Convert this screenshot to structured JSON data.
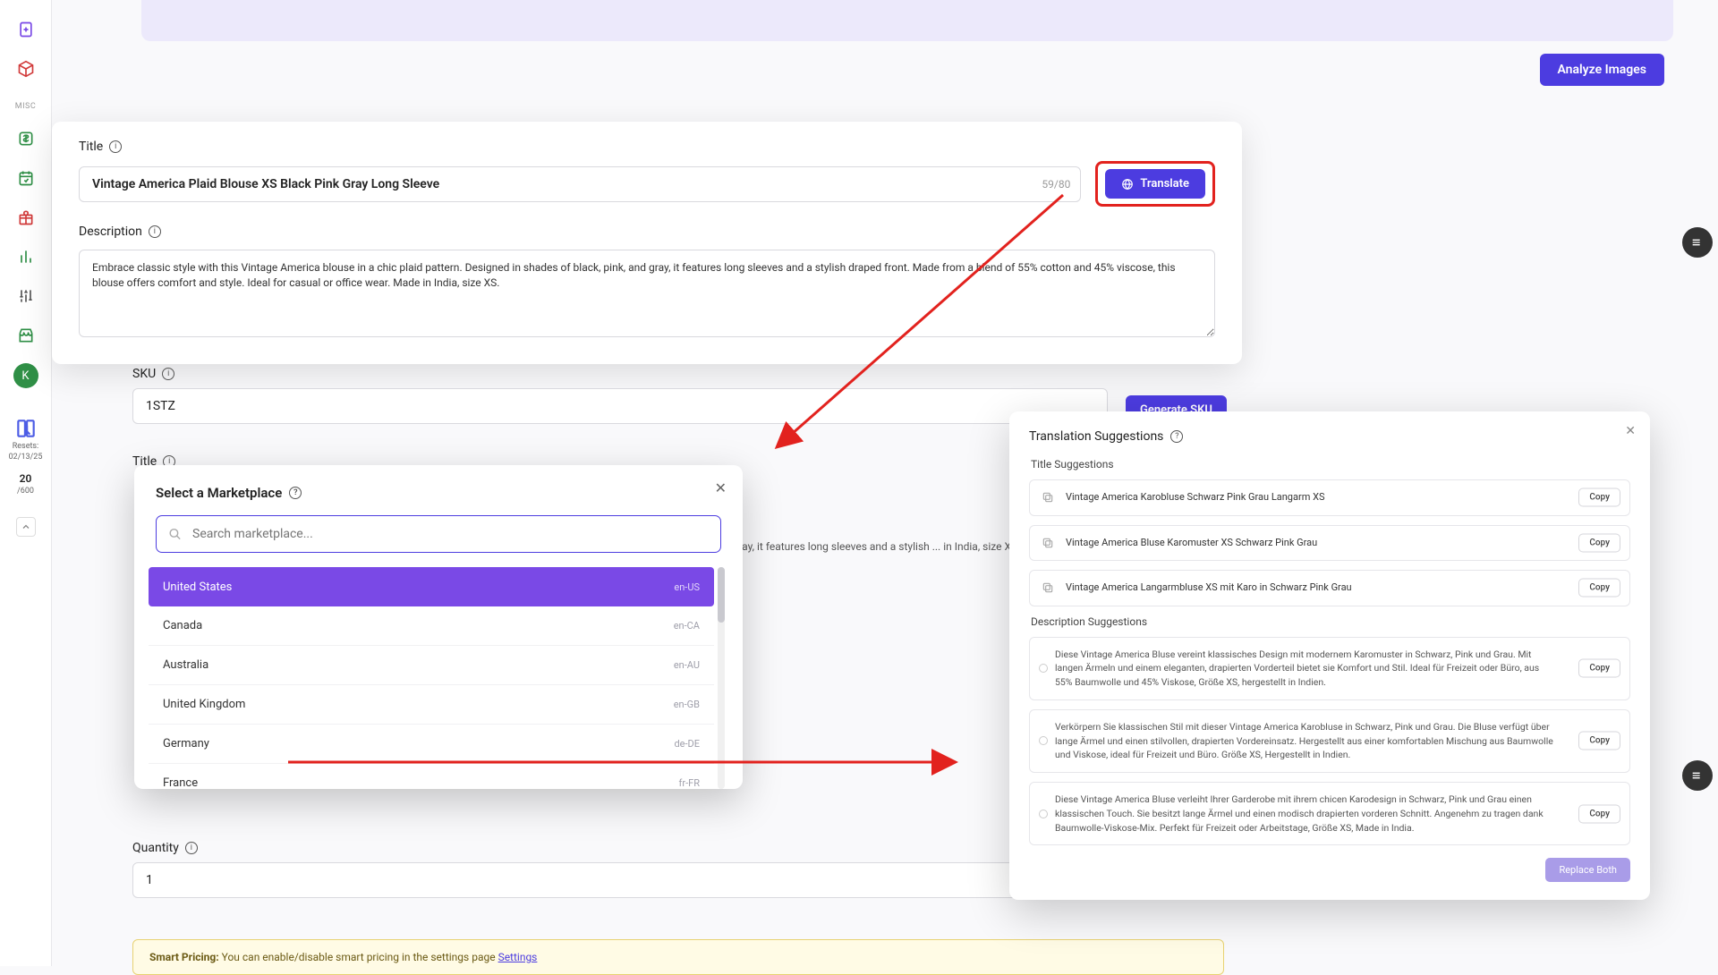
{
  "sidebar": {
    "misc_label": "MISC",
    "avatar_initial": "K",
    "resets_label": "Resets:",
    "resets_date": "02/13/25",
    "count_current": "20",
    "count_max": "/600"
  },
  "header": {
    "analyze_button": "Analyze Images"
  },
  "title_card": {
    "title_label": "Title",
    "title_value": "Vintage America Plaid Blouse XS Black Pink Gray Long Sleeve",
    "title_counter": "59/80",
    "translate_button": "Translate",
    "description_label": "Description",
    "description_value": "Embrace classic style with this Vintage America blouse in a chic plaid pattern. Designed in shades of black, pink, and gray, it features long sleeves and a stylish draped front. Made from a blend of 55% cotton and 45% viscose, this blouse offers comfort and style. Ideal for casual or office wear. Made in India, size XS."
  },
  "sku": {
    "label": "SKU",
    "value": "1STZ",
    "generate_button": "Generate SKU"
  },
  "title2": {
    "label": "Title"
  },
  "quantity": {
    "label": "Quantity",
    "value": "1"
  },
  "bg_desc_snippet": "pink, and gray, it features long sleeves and a stylish ... in India, size XS.",
  "smart_pricing": {
    "bold": "Smart Pricing:",
    "text": " You can enable/disable smart pricing in the settings page ",
    "link": "Settings"
  },
  "marketplace": {
    "title": "Select a Marketplace",
    "search_placeholder": "Search marketplace...",
    "items": [
      {
        "name": "United States",
        "code": "en-US",
        "selected": true
      },
      {
        "name": "Canada",
        "code": "en-CA",
        "selected": false
      },
      {
        "name": "Australia",
        "code": "en-AU",
        "selected": false
      },
      {
        "name": "United Kingdom",
        "code": "en-GB",
        "selected": false
      },
      {
        "name": "Germany",
        "code": "de-DE",
        "selected": false
      },
      {
        "name": "France",
        "code": "fr-FR",
        "selected": false
      }
    ]
  },
  "translation": {
    "header": "Translation Suggestions",
    "title_sub": "Title Suggestions",
    "desc_sub": "Description Suggestions",
    "copy_label": "Copy",
    "replace_button": "Replace Both",
    "titles": [
      "Vintage America Karobluse Schwarz Pink Grau Langarm XS",
      "Vintage America Bluse Karomuster XS Schwarz Pink Grau",
      "Vintage America Langarmbluse XS mit Karo in Schwarz Pink Grau"
    ],
    "descriptions": [
      "Diese Vintage America Bluse vereint klassisches Design mit modernem Karomuster in Schwarz, Pink und Grau. Mit langen Ärmeln und einem eleganten, drapierten Vorderteil bietet sie Komfort und Stil. Ideal für Freizeit oder Büro, aus 55% Baumwolle und 45% Viskose, Größe XS, hergestellt in Indien.",
      "Verkörpern Sie klassischen Stil mit dieser Vintage America Karobluse in Schwarz, Pink und Grau. Die Bluse verfügt über lange Ärmel und einen stilvollen, drapierten Vordereinsatz. Hergestellt aus einer komfortablen Mischung aus Baumwolle und Viskose, ideal für Freizeit und Büro. Größe XS, Hergestellt in Indien.",
      "Diese Vintage America Bluse verleiht Ihrer Garderobe mit ihrem chicen Karodesign in Schwarz, Pink und Grau einen klassischen Touch. Sie besitzt lange Ärmel und einen modisch drapierten vorderen Schnitt. Angenehm zu tragen dank Baumwolle-Viskose-Mix. Perfekt für Freizeit oder Arbeitstage, Größe XS, Made in India."
    ]
  }
}
